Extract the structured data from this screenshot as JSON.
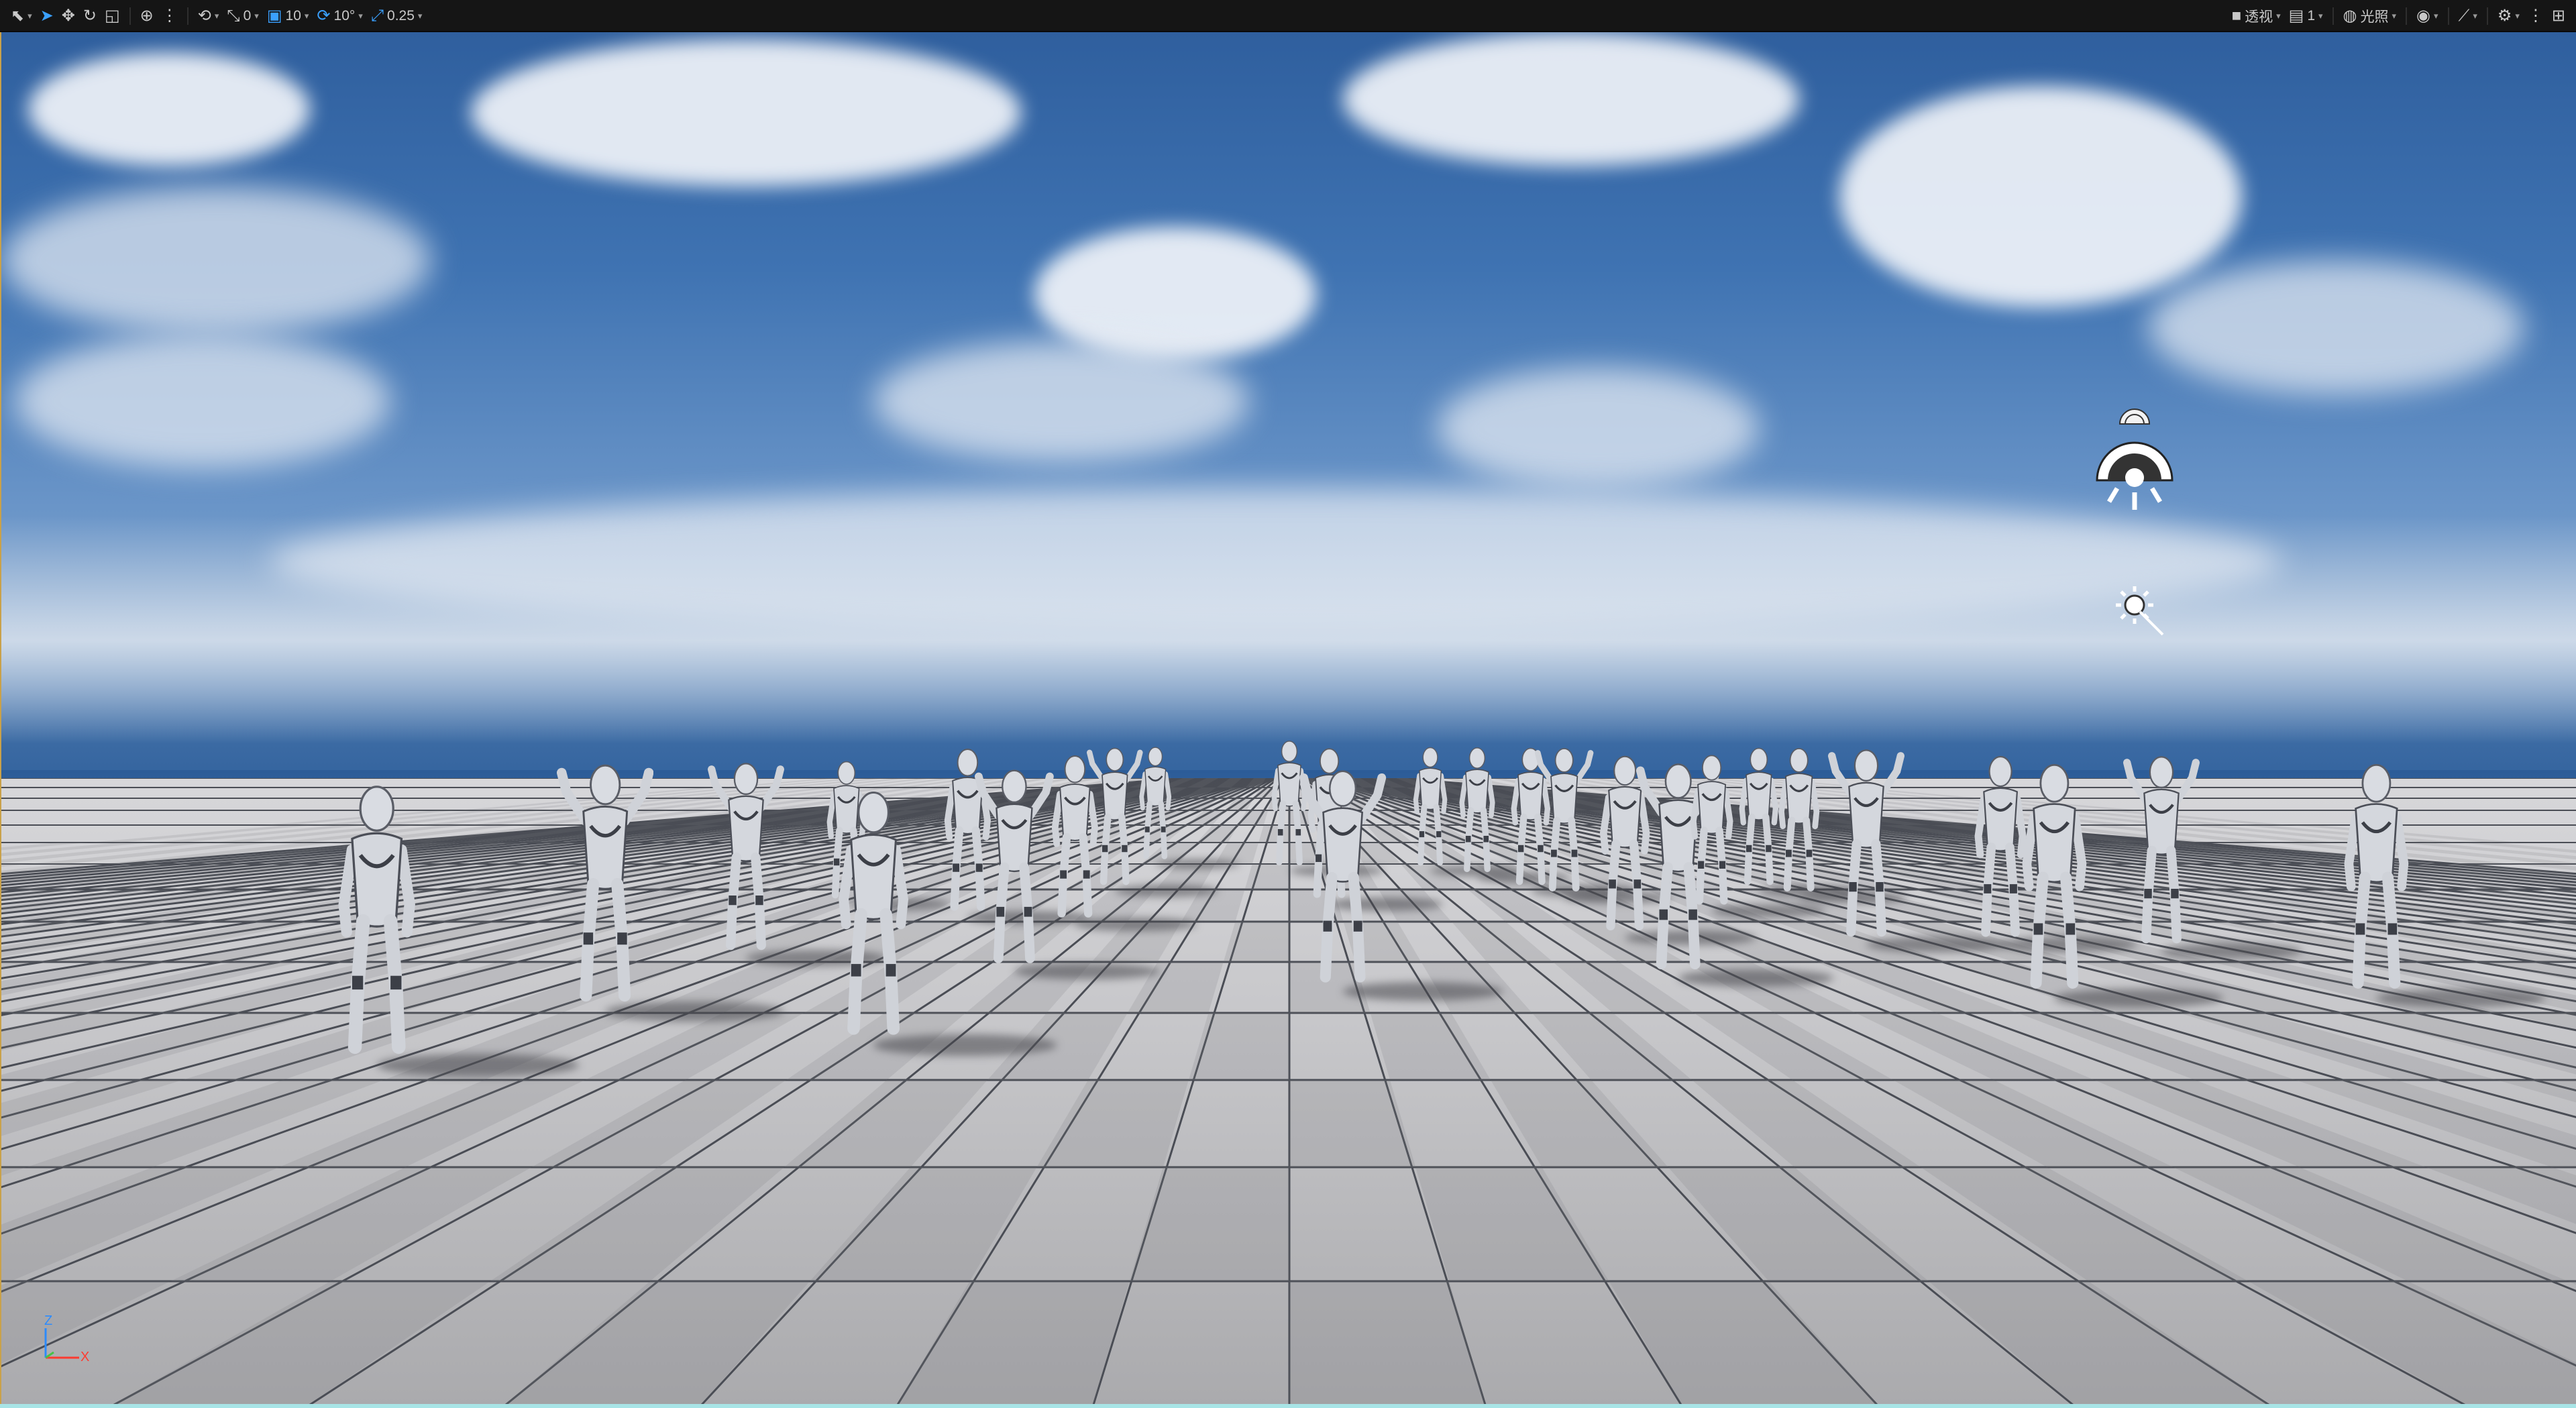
{
  "toolbar": {
    "left": {
      "select_mode_icon": "select-mode-icon",
      "transform_tools": [
        "select-arrow-icon",
        "move-icon",
        "rotate-icon",
        "scale-icon"
      ],
      "world_space_icon": "globe-icon",
      "surface_snap_icon": "snap-icon",
      "grid_snap": {
        "icon": "grid-snap-icon",
        "value": "0"
      },
      "grid_size": {
        "icon": "grid-size-icon",
        "value": "10"
      },
      "rotation_snap": {
        "icon": "rotation-snap-icon",
        "value": "10°"
      },
      "scale_snap": {
        "icon": "scale-snap-icon",
        "value": "0.25"
      }
    },
    "right": {
      "perspective": {
        "icon": "camera-icon",
        "label": "透视"
      },
      "layout": {
        "icon": "layout-icon",
        "label": "1"
      },
      "lighting": {
        "icon": "lighting-icon",
        "label": "光照"
      },
      "show_icon": "eye-icon",
      "realtime_icon": "realtime-icon",
      "performance_icon": "gear-icon",
      "more_icon": "more-icon",
      "viewport_layout_icon": "viewport-layout-icon"
    }
  },
  "viewport": {
    "axis": {
      "z": "Z",
      "x": "X"
    },
    "gizmos": [
      "sky-atmosphere-icon",
      "directional-light-icon",
      "exponential-height-fog-icon"
    ]
  },
  "colors": {
    "accent": "#3aa0ff",
    "viewport_border": "#c9a14a",
    "toolbar_bg": "#151515"
  }
}
